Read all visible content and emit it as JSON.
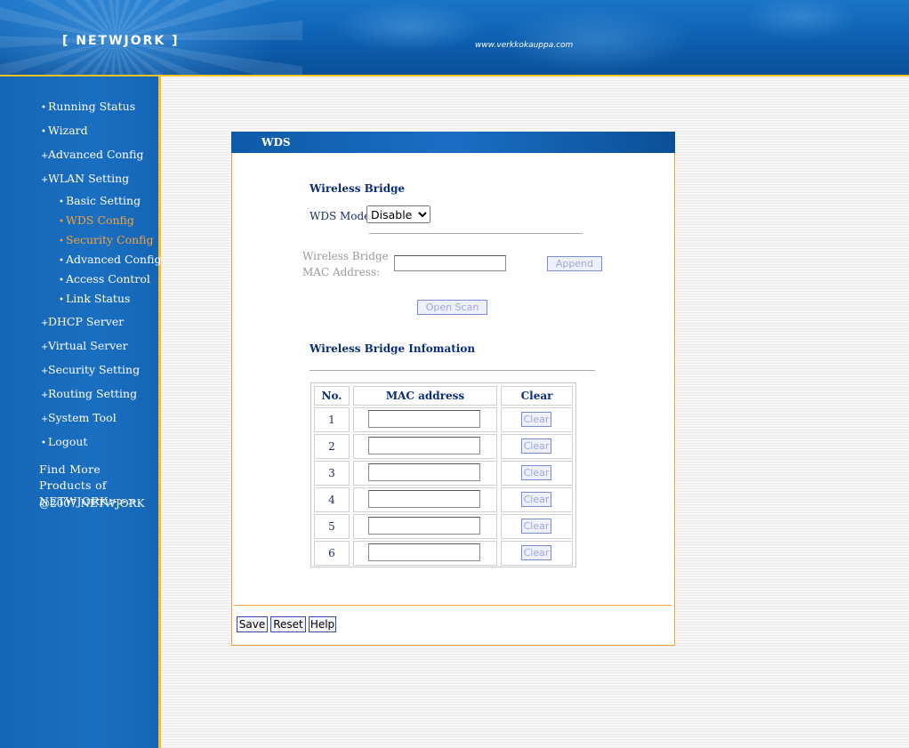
{
  "header": {
    "brand": "[ NETWJORK ]",
    "url": "www.verkkokauppa.com"
  },
  "sidebar": {
    "items": [
      {
        "label": "Running Status",
        "marker": "•"
      },
      {
        "label": "Wizard",
        "marker": "•"
      },
      {
        "label": "Advanced Config",
        "marker": "+"
      },
      {
        "label": "WLAN Setting",
        "marker": "+"
      },
      {
        "label": "Basic Setting",
        "marker": "•"
      },
      {
        "label": "WDS Config",
        "marker": "•"
      },
      {
        "label": "Security Config",
        "marker": "•"
      },
      {
        "label": "Advanced Config",
        "marker": "•"
      },
      {
        "label": "Access Control",
        "marker": "•"
      },
      {
        "label": "Link Status",
        "marker": "•"
      },
      {
        "label": "DHCP Server",
        "marker": "+"
      },
      {
        "label": "Virtual Server",
        "marker": "+"
      },
      {
        "label": "Security Setting",
        "marker": "+"
      },
      {
        "label": "Routing Setting",
        "marker": "+"
      },
      {
        "label": "System Tool",
        "marker": "+"
      },
      {
        "label": "Logout",
        "marker": "•"
      }
    ],
    "find_more": "Find More Products of NETWJORK>>>",
    "copyright": "@2007 NETWJORK"
  },
  "panel": {
    "title": "WDS",
    "bridge": {
      "title": "Wireless Bridge",
      "mode_label": "WDS Mode:",
      "mode_value": "Disable",
      "mode_options": [
        "Disable"
      ],
      "mac_label_1": "Wireless Bridge",
      "mac_label_2": "MAC Address:",
      "mac_value": "",
      "append_label": "Append",
      "open_scan_label": "Open Scan"
    },
    "info": {
      "title": "Wireless Bridge Infomation",
      "columns": [
        "No.",
        "MAC address",
        "Clear"
      ],
      "rows": [
        {
          "no": "1",
          "mac": "",
          "clear": "Clear"
        },
        {
          "no": "2",
          "mac": "",
          "clear": "Clear"
        },
        {
          "no": "3",
          "mac": "",
          "clear": "Clear"
        },
        {
          "no": "4",
          "mac": "",
          "clear": "Clear"
        },
        {
          "no": "5",
          "mac": "",
          "clear": "Clear"
        },
        {
          "no": "6",
          "mac": "",
          "clear": "Clear"
        }
      ]
    },
    "buttons": {
      "save": "Save",
      "reset": "Reset",
      "help": "Help"
    }
  }
}
